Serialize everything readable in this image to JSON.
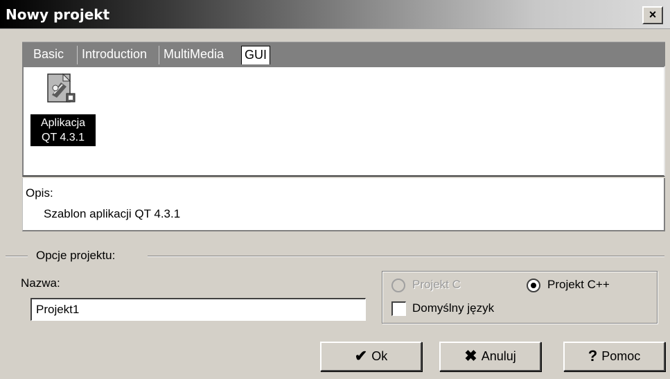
{
  "window": {
    "title": "Nowy projekt",
    "close_label": "×"
  },
  "tabs": [
    {
      "label": "Basic",
      "active": false
    },
    {
      "label": "Introduction",
      "active": false
    },
    {
      "label": "MultiMedia",
      "active": false
    },
    {
      "label": "GUI",
      "active": true
    }
  ],
  "templates": [
    {
      "label_line1": "Aplikacja",
      "label_line2": "QT 4.3.1",
      "selected": true,
      "icon": "qt-app-icon"
    }
  ],
  "description": {
    "label": "Opis:",
    "text": "Szablon aplikacji QT 4.3.1"
  },
  "options": {
    "group_title": "Opcje projektu:",
    "name_label": "Nazwa:",
    "name_value": "Projekt1",
    "radio_c_label": "Projekt C",
    "radio_c_enabled": false,
    "radio_cpp_label": "Projekt C++",
    "selected_radio": "Projekt C++",
    "default_lang_label": "Domyślny język",
    "default_lang_checked": false
  },
  "buttons": {
    "ok_label": "Ok",
    "ok_icon": "checkmark-icon",
    "cancel_label": "Anuluj",
    "cancel_icon": "x-icon",
    "help_label": "Pomoc",
    "help_icon": "question-icon"
  },
  "colors": {
    "dialog_bg": "#d4d0c8",
    "tabstrip_bg": "#808080",
    "selection_bg": "#000000"
  }
}
